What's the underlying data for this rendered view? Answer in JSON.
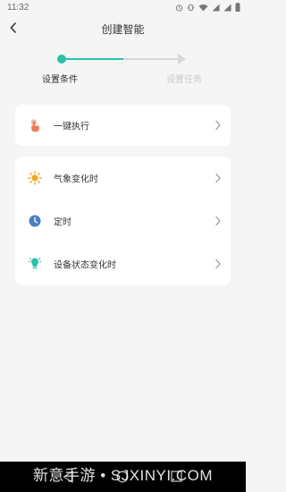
{
  "status_bar": {
    "time": "11:32",
    "icons": [
      "alarm-icon",
      "vibrate-icon",
      "wifi-icon",
      "signal-icon",
      "signal-icon",
      "battery-icon"
    ]
  },
  "header": {
    "back_icon": "chevron-left-icon",
    "title": "创建智能"
  },
  "stepper": {
    "steps": [
      {
        "label": "设置条件",
        "state": "active"
      },
      {
        "label": "设置任务",
        "state": "inactive"
      }
    ],
    "colors": {
      "active": "#29c2a7",
      "inactive": "#d8d8d8"
    }
  },
  "cards": [
    {
      "items": [
        {
          "label": "一键执行",
          "icon": "tap-hand-icon",
          "icon_color": "#f07c5a"
        }
      ]
    },
    {
      "items": [
        {
          "label": "气象变化时",
          "icon": "sun-icon",
          "icon_color": "#f5a623"
        },
        {
          "label": "定时",
          "icon": "clock-icon",
          "icon_color": "#4a7fc1"
        },
        {
          "label": "设备状态变化时",
          "icon": "lamp-icon",
          "icon_color": "#29c2a7"
        }
      ]
    }
  ],
  "watermark": "新意手游 • SJXINYI.COM"
}
